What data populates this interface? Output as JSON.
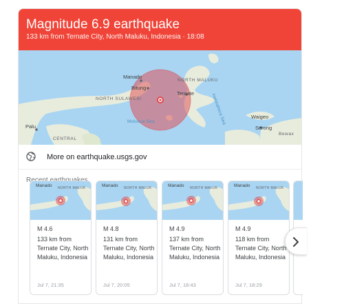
{
  "header": {
    "title": "Magnitude 6.9 earthquake",
    "subtitle": "133 km from Ternate City, North Maluku, Indonesia · 18:08"
  },
  "map": {
    "labels": {
      "manado": "Manado",
      "bitung": "Bitung",
      "north_maluku": "NORTH MALUKU",
      "north_sulawesi": "NORTH SULAWESI",
      "ternate": "Ternate",
      "halmahera_sea": "Halmahera Sea",
      "molucca_sea": "Molucca Sea",
      "palu": "Palu",
      "central": "CENTRAL",
      "waigeo": "Waigeo",
      "sorong": "Sorong",
      "bewax": "Bewax"
    },
    "colors": {
      "water": "#a9d5f2",
      "land": "#e8ecdd",
      "quake": "#e0484e"
    }
  },
  "usgs_link": {
    "icon": "globe-icon",
    "label": "More on earthquake.usgs.gov"
  },
  "recent": {
    "title": "Recent earthquakes",
    "cards": [
      {
        "thumb_manado": "Manado",
        "thumb_region": "NORTH MALUK",
        "magnitude": "M 4.6",
        "location": "133 km from Ternate City, North Maluku, Indonesia",
        "time": "Jul 7, 21:35"
      },
      {
        "thumb_manado": "Manado",
        "thumb_region": "NORTH MALUK",
        "magnitude": "M 4.8",
        "location": "131 km from Ternate City, North Maluku, Indonesia",
        "time": "Jul 7, 20:05"
      },
      {
        "thumb_manado": "Manado",
        "thumb_region": "NORTH MALUK",
        "magnitude": "M 4.9",
        "location": "137 km from Ternate City, North Maluku, Indonesia",
        "time": "Jul 7, 18:43"
      },
      {
        "thumb_manado": "Manado",
        "thumb_region": "NORTH MALUK",
        "magnitude": "M 4.9",
        "location": "118 km from Ternate City, North Maluku, Indonesia",
        "time": "Jul 7, 18:29"
      }
    ]
  },
  "next_button_icon": "chevron-right-icon",
  "brand": {
    "header_red": "#f04438"
  }
}
